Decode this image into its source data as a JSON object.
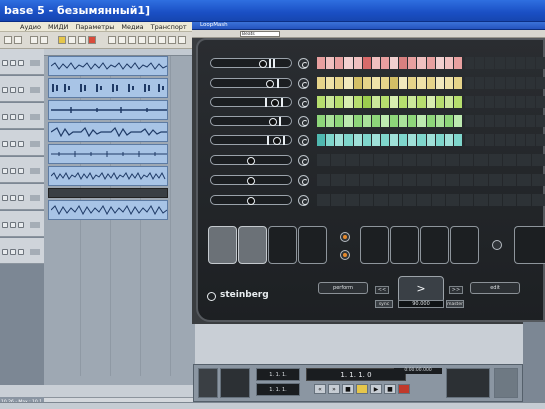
{
  "cubase": {
    "title": "base 5 - безымянный1]",
    "menu": [
      "Аудио",
      "МИДИ",
      "Параметры",
      "Медиа",
      "Транспорт"
    ],
    "status_text": "10.26 - Max : 10.1"
  },
  "loopmash": {
    "window_title": "LoopMash",
    "preset_dropdown": "Beats",
    "brand": "steinberg",
    "tabs": {
      "perform": "perform",
      "edit": "edit"
    },
    "play_symbol": ">",
    "nav_buttons": [
      "<<",
      ">>",
      "sync",
      "master"
    ],
    "tempo": "90.000"
  },
  "transport": {
    "position": "1. 1. 1. 0",
    "left_locator": "1. 1. 1.",
    "right_locator": "1. 1. 1.",
    "time_display": "0:00:00.000"
  },
  "colors": {
    "row1": "#e8a0a0",
    "row2": "#e6d48a",
    "row3": "#b6de6e",
    "row4": "#8ed67a",
    "row5": "#7fd6cc"
  }
}
